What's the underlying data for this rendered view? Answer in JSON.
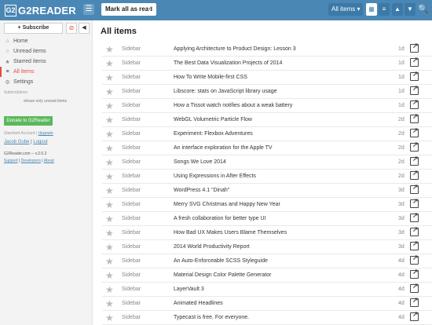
{
  "header": {
    "logo_text": "G2READER",
    "logo_mark": "G2",
    "menu_icon": "☰",
    "mark_all_read": "Mark all as read",
    "refresh_icon": "⟳",
    "filter": "All items ▾",
    "view_cards_icon": "▦",
    "view_list_icon": "≡",
    "prev_icon": "▲",
    "next_icon": "▼",
    "search_icon": "🔍"
  },
  "sidebar": {
    "subscribe": "+ Subscribe",
    "sync_icon": "⊘",
    "collapse_icon": "◀",
    "nav": [
      {
        "label": "Home",
        "icon": "⌂"
      },
      {
        "label": "Unread items",
        "icon": "○"
      },
      {
        "label": "Starred items",
        "icon": "★"
      },
      {
        "label": "All items",
        "icon": "≡"
      },
      {
        "label": "Settings",
        "icon": "⚙"
      }
    ],
    "subscriptions_heading": "Subscriptions",
    "subscriptions_note": "shows only unread items",
    "donate": "Donate to G2Reader",
    "account_text": "Standard Account",
    "account_sep": " | ",
    "upgrade": "Upgrade",
    "user_name": "Jacob Gube",
    "user_sep": " | ",
    "logout": "Logout",
    "version": "G2Reader.com -- v.2.0.2",
    "link_support": "Support",
    "link_sep1": " | ",
    "link_developers": "Developers",
    "link_sep2": " | ",
    "link_about": "About"
  },
  "main": {
    "title": "All items",
    "items": [
      {
        "feed": "Sidebar",
        "title": "Applying Architecture to Product Design: Lesson 3",
        "age": "1d"
      },
      {
        "feed": "Sidebar",
        "title": "The Best Data Visualization Projects of 2014",
        "age": "1d"
      },
      {
        "feed": "Sidebar",
        "title": "How To Write Mobile-first CSS",
        "age": "1d"
      },
      {
        "feed": "Sidebar",
        "title": "Libscore: stats on JavaScript library usage",
        "age": "1d"
      },
      {
        "feed": "Sidebar",
        "title": "How a Tissot watch notifies about a weak battery",
        "age": "1d"
      },
      {
        "feed": "Sidebar",
        "title": "WebGL Volumetric Particle Flow",
        "age": "2d"
      },
      {
        "feed": "Sidebar",
        "title": "Experiment: Flexbox Adventures",
        "age": "2d"
      },
      {
        "feed": "Sidebar",
        "title": "An interface exploration for the Apple TV",
        "age": "2d"
      },
      {
        "feed": "Sidebar",
        "title": "Songs We Love 2014",
        "age": "2d"
      },
      {
        "feed": "Sidebar",
        "title": "Using Expressions in After Effects",
        "age": "2d"
      },
      {
        "feed": "Sidebar",
        "title": "WordPress 4.1 “Dinah”",
        "age": "3d"
      },
      {
        "feed": "Sidebar",
        "title": "Merry SVG Christmas and Happy New Year",
        "age": "3d"
      },
      {
        "feed": "Sidebar",
        "title": "A fresh collaboration for better type UI",
        "age": "3d"
      },
      {
        "feed": "Sidebar",
        "title": "How Bad UX Makes Users Blame Themselves",
        "age": "3d"
      },
      {
        "feed": "Sidebar",
        "title": "2014 World Productivity Report",
        "age": "3d"
      },
      {
        "feed": "Sidebar",
        "title": "An Auto-Enforceable SCSS Styleguide",
        "age": "4d"
      },
      {
        "feed": "Sidebar",
        "title": "Material Design Color Palette Generator",
        "age": "4d"
      },
      {
        "feed": "Sidebar",
        "title": "LayerVault 3",
        "age": "4d"
      },
      {
        "feed": "Sidebar",
        "title": "Animated Headlines",
        "age": "4d"
      },
      {
        "feed": "Sidebar",
        "title": "Typecast is free. For everyone.",
        "age": "4d"
      }
    ]
  }
}
